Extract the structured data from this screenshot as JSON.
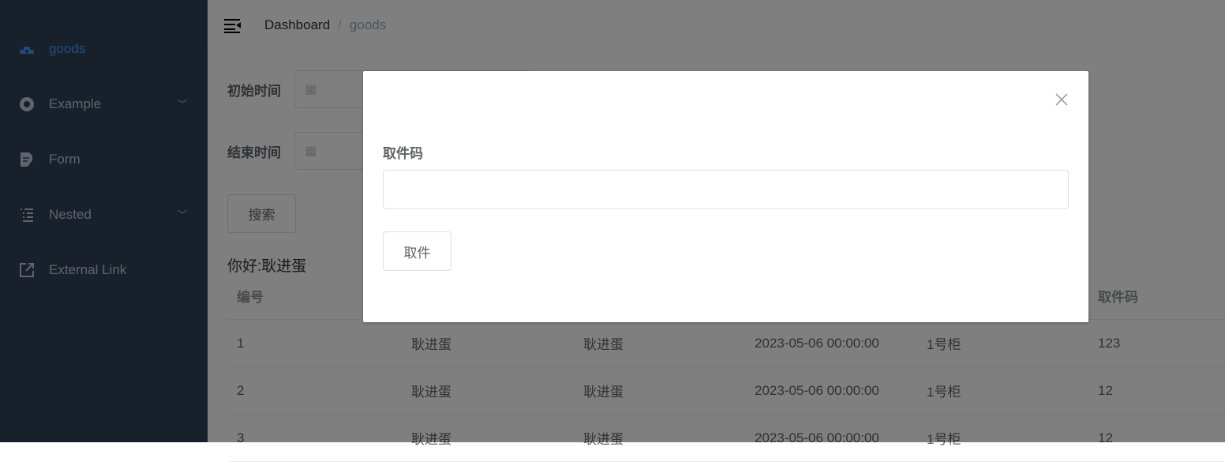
{
  "sidebar": {
    "items": [
      {
        "label": "goods",
        "icon": "dashboard-icon",
        "active": true
      },
      {
        "label": "Example",
        "icon": "example-icon",
        "expandable": true
      },
      {
        "label": "Form",
        "icon": "form-icon"
      },
      {
        "label": "Nested",
        "icon": "nested-icon",
        "expandable": true
      },
      {
        "label": "External Link",
        "icon": "external-link-icon"
      }
    ]
  },
  "navbar": {
    "breadcrumb": [
      "Dashboard",
      "goods"
    ],
    "separator": "/"
  },
  "filters": {
    "start_label": "初始时间",
    "end_label": "结束时间",
    "search_label": "搜索"
  },
  "greeting": "你好:耿进蛋",
  "table": {
    "headers": [
      "编号",
      "",
      "",
      "",
      "",
      "取件码"
    ],
    "rows": [
      [
        "1",
        "耿进蛋",
        "耿进蛋",
        "2023-05-06 00:00:00",
        "1号柜",
        "123"
      ],
      [
        "2",
        "耿进蛋",
        "耿进蛋",
        "2023-05-06 00:00:00",
        "1号柜",
        "12"
      ],
      [
        "3",
        "耿进蛋",
        "耿进蛋",
        "2023-05-06 00:00:00",
        "1号柜",
        "12"
      ]
    ]
  },
  "dialog": {
    "field_label": "取件码",
    "field_value": "",
    "button_label": "取件"
  },
  "colors": {
    "sidebar": "#304156",
    "active": "#409eff",
    "overlay": "rgba(0,0,0,0.5)"
  }
}
